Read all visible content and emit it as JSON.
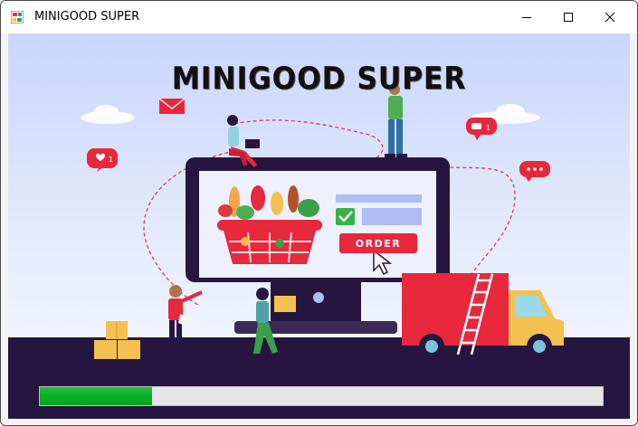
{
  "window": {
    "title": "MINIGOOD SUPER",
    "controls": {
      "minimize": "minimize-icon",
      "maximize": "maximize-icon",
      "close": "close-icon"
    }
  },
  "splash": {
    "headline": "MINIGOOD SUPER",
    "order_button": "ORDER"
  },
  "progress": {
    "fraction": 0.2,
    "color": "#06b025"
  },
  "colors": {
    "accent_red": "#e8283c",
    "ground": "#26163f",
    "sky": "#c9d6fb"
  }
}
